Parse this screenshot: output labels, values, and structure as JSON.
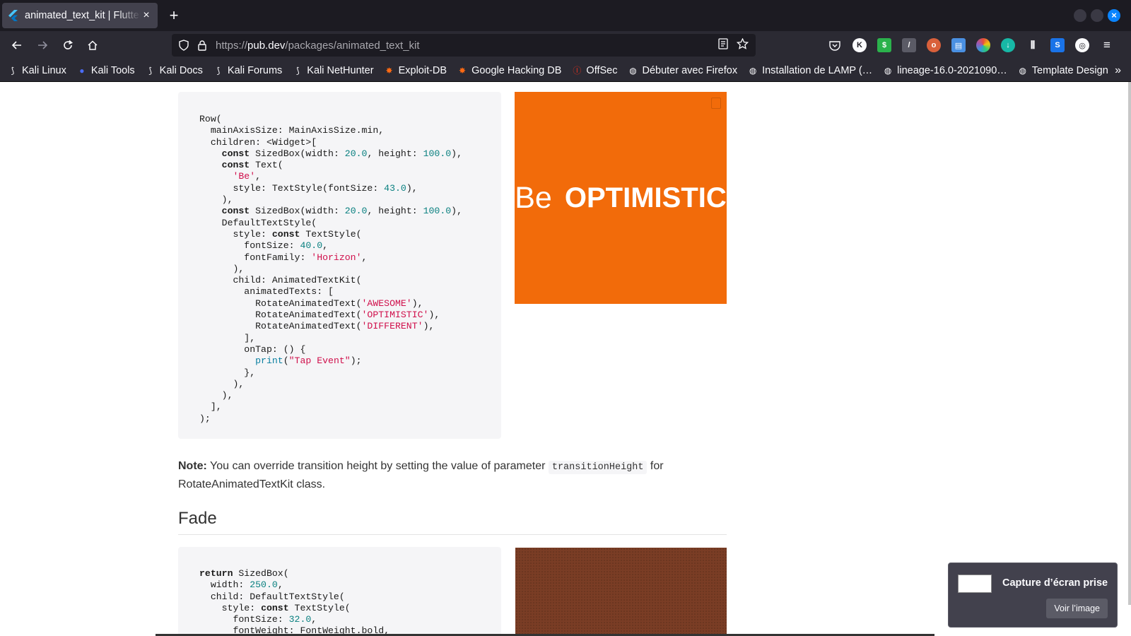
{
  "tab": {
    "title": "animated_text_kit | Flutter",
    "close_glyph": "×",
    "favicon": "flutter-icon"
  },
  "newtab_glyph": "+",
  "urlbar": {
    "scheme": "https://",
    "host": "pub.dev",
    "path": "/packages/animated_text_kit"
  },
  "bookmarks": [
    {
      "label": "Kali Linux",
      "icon": "kali-dragon-icon"
    },
    {
      "label": "Kali Tools",
      "icon": "kali-tools-icon"
    },
    {
      "label": "Kali Docs",
      "icon": "kali-dragon-icon"
    },
    {
      "label": "Kali Forums",
      "icon": "kali-dragon-icon"
    },
    {
      "label": "Kali NetHunter",
      "icon": "kali-dragon-icon"
    },
    {
      "label": "Exploit-DB",
      "icon": "exploit-db-icon"
    },
    {
      "label": "Google Hacking DB",
      "icon": "exploit-db-icon"
    },
    {
      "label": "OffSec",
      "icon": "offsec-icon"
    },
    {
      "label": "Débuter avec Firefox",
      "icon": "globe-icon"
    },
    {
      "label": "Installation de LAMP (…",
      "icon": "globe-icon"
    },
    {
      "label": "lineage-16.0-2021090…",
      "icon": "globe-icon"
    },
    {
      "label": "Template Design",
      "icon": "globe-icon"
    }
  ],
  "bookmarks_more": "»",
  "code1": [
    [
      [
        "p",
        "Row("
      ]
    ],
    [
      [
        "p",
        "  mainAxisSize: MainAxisSize.min,"
      ]
    ],
    [
      [
        "p",
        "  children: <Widget>["
      ]
    ],
    [
      [
        "p",
        "    "
      ],
      [
        "k",
        "const"
      ],
      [
        "p",
        " SizedBox(width: "
      ],
      [
        "n",
        "20.0"
      ],
      [
        "p",
        ", height: "
      ],
      [
        "n",
        "100.0"
      ],
      [
        "p",
        "),"
      ]
    ],
    [
      [
        "p",
        "    "
      ],
      [
        "k",
        "const"
      ],
      [
        "p",
        " Text("
      ]
    ],
    [
      [
        "p",
        "      "
      ],
      [
        "s",
        "'Be'"
      ],
      [
        "p",
        ","
      ]
    ],
    [
      [
        "p",
        "      style: TextStyle(fontSize: "
      ],
      [
        "n",
        "43.0"
      ],
      [
        "p",
        "),"
      ]
    ],
    [
      [
        "p",
        "    ),"
      ]
    ],
    [
      [
        "p",
        "    "
      ],
      [
        "k",
        "const"
      ],
      [
        "p",
        " SizedBox(width: "
      ],
      [
        "n",
        "20.0"
      ],
      [
        "p",
        ", height: "
      ],
      [
        "n",
        "100.0"
      ],
      [
        "p",
        "),"
      ]
    ],
    [
      [
        "p",
        "    DefaultTextStyle("
      ]
    ],
    [
      [
        "p",
        "      style: "
      ],
      [
        "k",
        "const"
      ],
      [
        "p",
        " TextStyle("
      ]
    ],
    [
      [
        "p",
        "        fontSize: "
      ],
      [
        "n",
        "40.0"
      ],
      [
        "p",
        ","
      ]
    ],
    [
      [
        "p",
        "        fontFamily: "
      ],
      [
        "s",
        "'Horizon'"
      ],
      [
        "p",
        ","
      ]
    ],
    [
      [
        "p",
        "      ),"
      ]
    ],
    [
      [
        "p",
        "      child: AnimatedTextKit("
      ]
    ],
    [
      [
        "p",
        "        animatedTexts: ["
      ]
    ],
    [
      [
        "p",
        "          RotateAnimatedText("
      ],
      [
        "s",
        "'AWESOME'"
      ],
      [
        "p",
        "),"
      ]
    ],
    [
      [
        "p",
        "          RotateAnimatedText("
      ],
      [
        "s",
        "'OPTIMISTIC'"
      ],
      [
        "p",
        "),"
      ]
    ],
    [
      [
        "p",
        "          RotateAnimatedText("
      ],
      [
        "s",
        "'DIFFERENT'"
      ],
      [
        "p",
        "),"
      ]
    ],
    [
      [
        "p",
        "        ],"
      ]
    ],
    [
      [
        "p",
        "        onTap: () {"
      ]
    ],
    [
      [
        "p",
        "          "
      ],
      [
        "f",
        "print"
      ],
      [
        "p",
        "("
      ],
      [
        "s",
        "\"Tap Event\""
      ],
      [
        "p",
        ");"
      ]
    ],
    [
      [
        "p",
        "        },"
      ]
    ],
    [
      [
        "p",
        "      ),"
      ]
    ],
    [
      [
        "p",
        "    ),"
      ]
    ],
    [
      [
        "p",
        "  ],"
      ]
    ],
    [
      [
        "p",
        ");"
      ]
    ]
  ],
  "demo1": {
    "be": "Be",
    "rotating": "OPTIMISTIC"
  },
  "note": {
    "bold": "Note:",
    "text1": " You can override transition height by setting the value of parameter ",
    "code": "transitionHeight",
    "text2": " for RotateAnimatedTextKit class."
  },
  "heading_fade": "Fade",
  "code2": [
    [
      [
        "k",
        "return"
      ],
      [
        "p",
        " SizedBox("
      ]
    ],
    [
      [
        "p",
        "  width: "
      ],
      [
        "n",
        "250.0"
      ],
      [
        "p",
        ","
      ]
    ],
    [
      [
        "p",
        "  child: DefaultTextStyle("
      ]
    ],
    [
      [
        "p",
        "    style: "
      ],
      [
        "k",
        "const"
      ],
      [
        "p",
        " TextStyle("
      ]
    ],
    [
      [
        "p",
        "      fontSize: "
      ],
      [
        "n",
        "32.0"
      ],
      [
        "p",
        ","
      ]
    ],
    [
      [
        "p",
        "      fontWeight: FontWeight.bold,"
      ]
    ]
  ],
  "toast": {
    "title": "Capture d’écran prise",
    "button": "Voir l’image"
  },
  "colors": {
    "demo1_bg": "#f26b0a",
    "demo2_bg": "#7a3d25",
    "browser_dark": "#2b2a33"
  }
}
